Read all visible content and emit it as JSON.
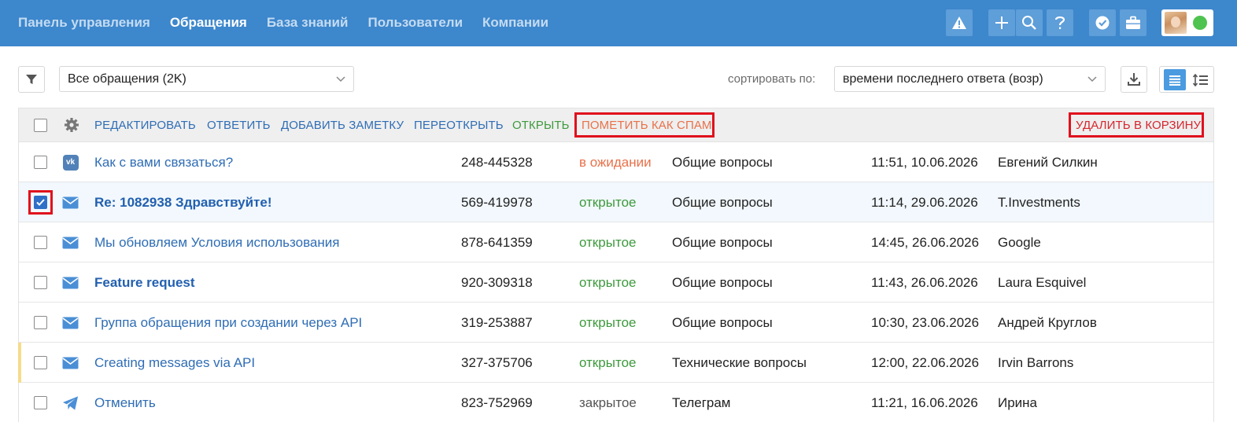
{
  "nav": {
    "items": [
      "Панель управления",
      "Обращения",
      "База знаний",
      "Пользователи",
      "Компании"
    ],
    "active_index": 1
  },
  "topbar_icons": [
    "warning-icon",
    "plus-icon",
    "search-icon",
    "help-icon",
    "verified-icon",
    "briefcase-icon"
  ],
  "filter": {
    "selected": "Все обращения (2K)"
  },
  "sort": {
    "label": "сортировать по:",
    "selected": "времени последнего ответа (возр)"
  },
  "actions": {
    "edit": "РЕДАКТИРОВАТЬ",
    "reply": "ОТВЕТИТЬ",
    "add_note": "ДОБАВИТЬ ЗАМЕТКУ",
    "reopen": "ПЕРЕОТКРЫТЬ",
    "open": "ОТКРЫТЬ",
    "mark_spam": "ПОМЕТИТЬ КАК СПАМ",
    "delete": "УДАЛИТЬ В КОРЗИНУ"
  },
  "colors": {
    "topbar": "#3d87cc",
    "link": "#2f6db5",
    "status_open": "#3d9a3d",
    "status_waiting": "#e8714a",
    "status_closed": "#555555",
    "highlight": "#e0101d"
  },
  "tickets": [
    {
      "channel": "vk-icon",
      "subject": "Как с вами связаться?",
      "bold": false,
      "number": "248-445328",
      "status": "в ожидании",
      "status_kind": "waiting",
      "group": "Общие вопросы",
      "time": "11:51, 10.06.2026",
      "client": "Евгений Силкин",
      "checked": false,
      "marker": false
    },
    {
      "channel": "mail-icon",
      "subject": "Re: 1082938 Здравствуйте!",
      "bold": true,
      "number": "569-419978",
      "status": "открытое",
      "status_kind": "open",
      "group": "Общие вопросы",
      "time": "11:14, 29.06.2026",
      "client": "T.Investments",
      "checked": true,
      "marker": false
    },
    {
      "channel": "mail-icon",
      "subject": "Мы обновляем Условия использования",
      "bold": false,
      "number": "878-641359",
      "status": "открытое",
      "status_kind": "open",
      "group": "Общие вопросы",
      "time": "14:45, 26.06.2026",
      "client": "Google",
      "checked": false,
      "marker": false
    },
    {
      "channel": "mail-icon",
      "subject": "Feature request",
      "bold": true,
      "number": "920-309318",
      "status": "открытое",
      "status_kind": "open",
      "group": "Общие вопросы",
      "time": "11:43, 26.06.2026",
      "client": "Laura Esquivel",
      "checked": false,
      "marker": false
    },
    {
      "channel": "mail-icon",
      "subject": "Группа обращения при создании через API",
      "bold": false,
      "number": "319-253887",
      "status": "открытое",
      "status_kind": "open",
      "group": "Общие вопросы",
      "time": "10:30, 23.06.2026",
      "client": "Андрей Круглов",
      "checked": false,
      "marker": false
    },
    {
      "channel": "mail-icon",
      "subject": "Creating messages via API",
      "bold": false,
      "number": "327-375706",
      "status": "открытое",
      "status_kind": "open",
      "group": "Технические вопросы",
      "time": "12:00, 22.06.2026",
      "client": "Irvin Barrons",
      "checked": false,
      "marker": true
    },
    {
      "channel": "telegram-icon",
      "subject": "Отменить",
      "bold": false,
      "number": "823-752969",
      "status": "закрытое",
      "status_kind": "closed",
      "group": "Телеграм",
      "time": "11:21, 16.06.2026",
      "client": "Ирина",
      "checked": false,
      "marker": false
    }
  ]
}
